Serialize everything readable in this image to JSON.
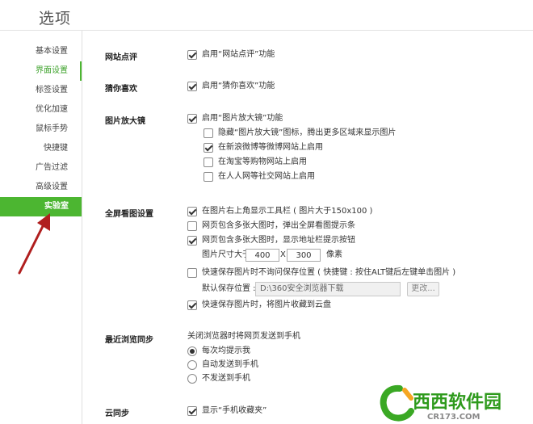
{
  "title": "选项",
  "sidebar": {
    "items": [
      {
        "label": "基本设置"
      },
      {
        "label": "界面设置"
      },
      {
        "label": "标签设置"
      },
      {
        "label": "优化加速"
      },
      {
        "label": "鼠标手势"
      },
      {
        "label": "快捷键"
      },
      {
        "label": "广告过滤"
      },
      {
        "label": "高级设置"
      },
      {
        "label": "实验室"
      }
    ]
  },
  "sections": {
    "site_review": {
      "label": "网站点评",
      "option": {
        "text": "启用“网站点评”功能",
        "checked": true
      }
    },
    "guess": {
      "label": "猜你喜欢",
      "option": {
        "text": "启用“猜你喜欢”功能",
        "checked": true
      }
    },
    "magnifier": {
      "label": "图片放大镜",
      "main": {
        "text": "启用“图片放大镜”功能",
        "checked": true
      },
      "sub": [
        {
          "text": "隐藏“图片放大镜”图标，腾出更多区域来显示图片",
          "checked": false
        },
        {
          "text": "在新浪微博等微博网站上启用",
          "checked": true
        },
        {
          "text": "在淘宝等购物网站上启用",
          "checked": false
        },
        {
          "text": "在人人网等社交网站上启用",
          "checked": false
        }
      ]
    },
    "fullscreen": {
      "label": "全屏看图设置",
      "options": [
        {
          "text": "在图片右上角显示工具栏 ( 图片大于150x100 )",
          "checked": true
        },
        {
          "text": "网页包含多张大图时，弹出全屏看图提示条",
          "checked": false
        },
        {
          "text": "网页包含多张大图时，显示地址栏提示按钮",
          "checked": true
        }
      ],
      "size_label": "图片尺寸大于",
      "width": "400",
      "x": "X",
      "height": "300",
      "unit": "像素",
      "quick_save": {
        "text": "快速保存图片时不询问保存位置 ( 快捷键 : 按住ALT键后左键单击图片 )",
        "checked": false
      },
      "default_location_label": "默认保存位置 :",
      "default_location_value": "D:\\360安全浏览器下载",
      "change_button": "更改...",
      "save_to_cloud": {
        "text": "快速保存图片时，将图片收藏到云盘",
        "checked": true
      }
    },
    "recent": {
      "label": "最近浏览同步",
      "desc": "关闭浏览器时将网页发送到手机",
      "radios": [
        {
          "text": "每次均提示我",
          "checked": true
        },
        {
          "text": "自动发送到手机",
          "checked": false
        },
        {
          "text": "不发送到手机",
          "checked": false
        }
      ]
    },
    "cloud": {
      "label": "云同步",
      "option": {
        "text": "显示“手机收藏夹”",
        "checked": true
      }
    }
  },
  "watermark": {
    "name": "西西软件园",
    "url": "CR173.COM"
  },
  "colors": {
    "accent": "#4cb631",
    "arrow": "#b01e1e"
  }
}
